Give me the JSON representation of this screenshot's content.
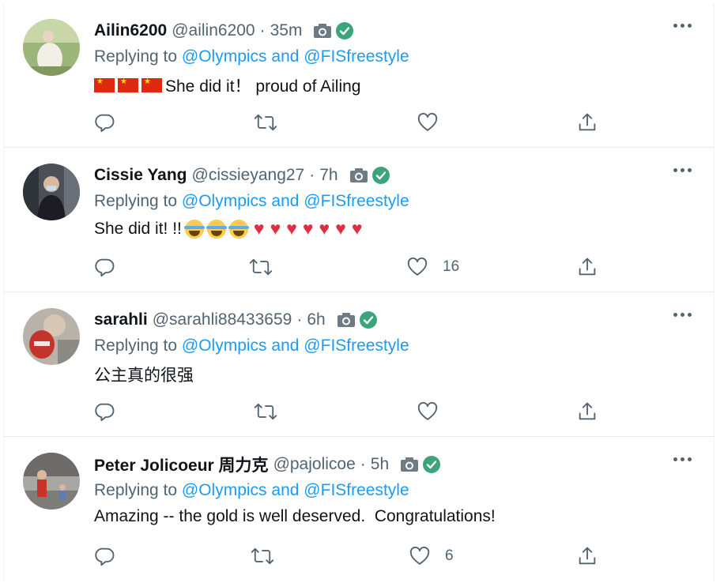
{
  "tweets": [
    {
      "name": "Ailin6200",
      "handle": "@ailin6200",
      "separator": "·",
      "time": "35m",
      "replying_prefix": "Replying to",
      "mention1": "@Olympics",
      "and": "and",
      "mention2": "@FISfreestyle",
      "text": "She did it！ proud of Ailing",
      "emoji_prefix": [
        "cn-flag",
        "cn-flag",
        "cn-flag"
      ],
      "reply_count": "",
      "retweet_count": "",
      "like_count": ""
    },
    {
      "name": "Cissie Yang",
      "handle": "@cissieyang27",
      "separator": "·",
      "time": "7h",
      "replying_prefix": "Replying to",
      "mention1": "@Olympics",
      "and": "and",
      "mention2": "@FISfreestyle",
      "text": "She did it! !!",
      "emoji_suffix": [
        "loudly-crying-face",
        "loudly-crying-face",
        "loudly-crying-face",
        "red-heart",
        "red-heart",
        "red-heart",
        "red-heart",
        "red-heart",
        "red-heart",
        "red-heart"
      ],
      "reply_count": "",
      "retweet_count": "",
      "like_count": "16"
    },
    {
      "name": "sarahli",
      "handle": "@sarahli88433659",
      "separator": "·",
      "time": "6h",
      "replying_prefix": "Replying to",
      "mention1": "@Olympics",
      "and": "and",
      "mention2": "@FISfreestyle",
      "text": "公主真的很强",
      "reply_count": "",
      "retweet_count": "",
      "like_count": ""
    },
    {
      "name": "Peter Jolicoeur 周力克",
      "handle": "@pajolicoe",
      "separator": "·",
      "time": "5h",
      "replying_prefix": "Replying to",
      "mention1": "@Olympics",
      "and": "and",
      "mention2": "@FISfreestyle",
      "text": "Amazing -- the gold is well deserved.  Congratulations!",
      "reply_count": "",
      "retweet_count": "",
      "like_count": "6"
    }
  ],
  "colors": {
    "accent": "#1d9bf0",
    "muted": "#536471",
    "verified": "#3ba47a",
    "heart": "#dd2e44"
  },
  "icons": [
    "camera-icon",
    "verified-icon",
    "more-icon",
    "reply-icon",
    "retweet-icon",
    "like-icon",
    "share-icon"
  ]
}
